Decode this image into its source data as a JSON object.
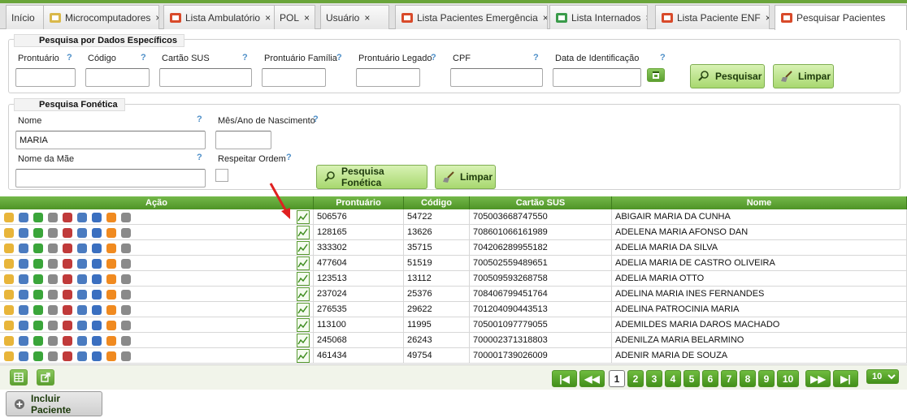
{
  "tabs": [
    {
      "label": "Início",
      "closable": false
    },
    {
      "label": "Microcomputadores",
      "closable": true
    },
    {
      "label": "Lista Ambulatório",
      "closable": true
    },
    {
      "label": "POL",
      "closable": true
    },
    {
      "label": "Usuário",
      "closable": true
    },
    {
      "label": "Lista Pacientes Emergência",
      "closable": true
    },
    {
      "label": "Lista Internados",
      "closable": true
    },
    {
      "label": "Lista Paciente ENF",
      "closable": true
    },
    {
      "label": "Pesquisar Pacientes",
      "closable": false
    }
  ],
  "tab_close_glyph": "×",
  "help_glyph": "?",
  "especificos": {
    "legend": "Pesquisa por Dados Específicos",
    "fields": {
      "prontuario": "Prontuário",
      "codigo": "Código",
      "cartao_sus": "Cartão SUS",
      "prontuario_familia": "Prontuário Família",
      "prontuario_legado": "Prontuário Legado",
      "cpf": "CPF",
      "data_identificacao": "Data de Identificação"
    },
    "pesquisar_label": "Pesquisar",
    "limpar_label": "Limpar"
  },
  "fonetica": {
    "legend": "Pesquisa Fonética",
    "nome_label": "Nome",
    "nome_value": "MARIA",
    "mes_ano_label": "Mês/Ano de Nascimento",
    "nome_mae_label": "Nome da Mãe",
    "respeitar_ordem_label": "Respeitar Ordem",
    "pesquisa_label": "Pesquisa Fonética",
    "limpar_label": "Limpar"
  },
  "grid": {
    "columns": [
      "Ação",
      "Prontuário",
      "Código",
      "Cartão SUS",
      "Nome"
    ],
    "rows": [
      [
        "506576",
        "54722",
        "705003668747550",
        "ABIGAIR MARIA DA CUNHA"
      ],
      [
        "128165",
        "13626",
        "708601066161989",
        "ADELENA MARIA AFONSO DAN"
      ],
      [
        "333302",
        "35715",
        "704206289955182",
        "ADELIA MARIA DA SILVA"
      ],
      [
        "477604",
        "51519",
        "700502559489651",
        "ADELIA MARIA DE CASTRO OLIVEIRA"
      ],
      [
        "123513",
        "13112",
        "700509593268758",
        "ADELIA MARIA OTTO"
      ],
      [
        "237024",
        "25376",
        "708406799451764",
        "ADELINA MARIA INES FERNANDES"
      ],
      [
        "276535",
        "29622",
        "701204090443513",
        "ADELINA PATROCINIA MARIA"
      ],
      [
        "113100",
        "11995",
        "705001097779055",
        "ADEMILDES MARIA DAROS MACHADO"
      ],
      [
        "245068",
        "26243",
        "700002371318803",
        "ADENILZA MARIA BELARMINO"
      ],
      [
        "461434",
        "49754",
        "700001739026009",
        "ADENIR MARIA DE SOUZA"
      ]
    ]
  },
  "pagination": {
    "first": "|◀",
    "prev": "◀◀",
    "next": "▶▶",
    "last": "▶|",
    "pages": [
      "1",
      "2",
      "3",
      "4",
      "5",
      "6",
      "7",
      "8",
      "9",
      "10"
    ],
    "current": "1",
    "rows_per_page": "10"
  },
  "incluir_paciente_label": "Incluir Paciente",
  "colors": {
    "accent": "#5b9f31",
    "header": "#4e9426",
    "arrow": "#e02020"
  }
}
